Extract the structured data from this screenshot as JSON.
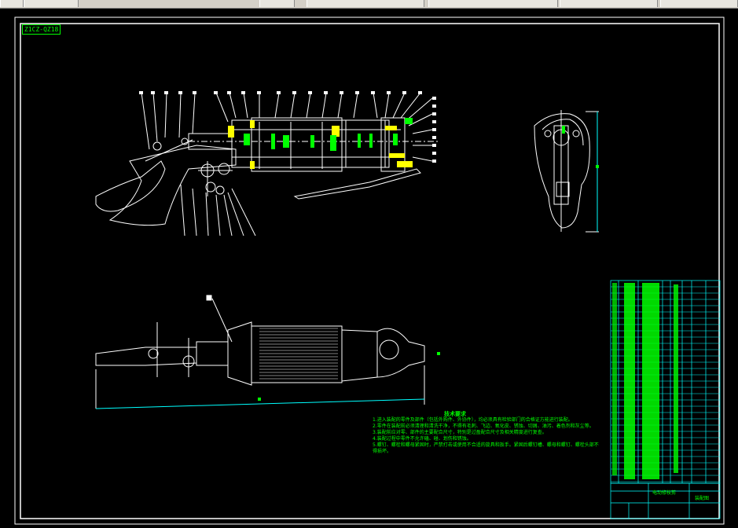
{
  "toolbar": {
    "buttons": [
      "",
      "",
      "",
      "",
      "",
      "",
      ""
    ]
  },
  "drawing": {
    "tag": "Z1CZ-QZ18",
    "notes_title": "技术要求",
    "notes": [
      "1.进入装配的零件及部件（包括外购件、外协件），均必须具有检验部门的合格证方能进行装配。",
      "2.零件在装配前必须清理和清洗干净，不得有毛刺、飞边、氧化皮、锈蚀、切屑、油污、着色剂和灰尘等。",
      "3.装配前应对零、部件的主要配合尺寸，特别是过盈配合尺寸及相关精度进行复查。",
      "4.装配过程中零件不允许磕、碰、划伤和锈蚀。",
      "5.螺钉、螺栓和螺母紧固时，严禁打击或使用不合适的旋具和扳手。紧固后螺钉槽、螺母和螺钉、螺栓头部不得损坏。"
    ],
    "title_block": {
      "name": "电动修枝剪",
      "label": "装配图"
    }
  },
  "colors": {
    "line": "#ffffff",
    "highlight": "#00ff00",
    "table": "#00ffff",
    "accent": "#ffff00"
  }
}
